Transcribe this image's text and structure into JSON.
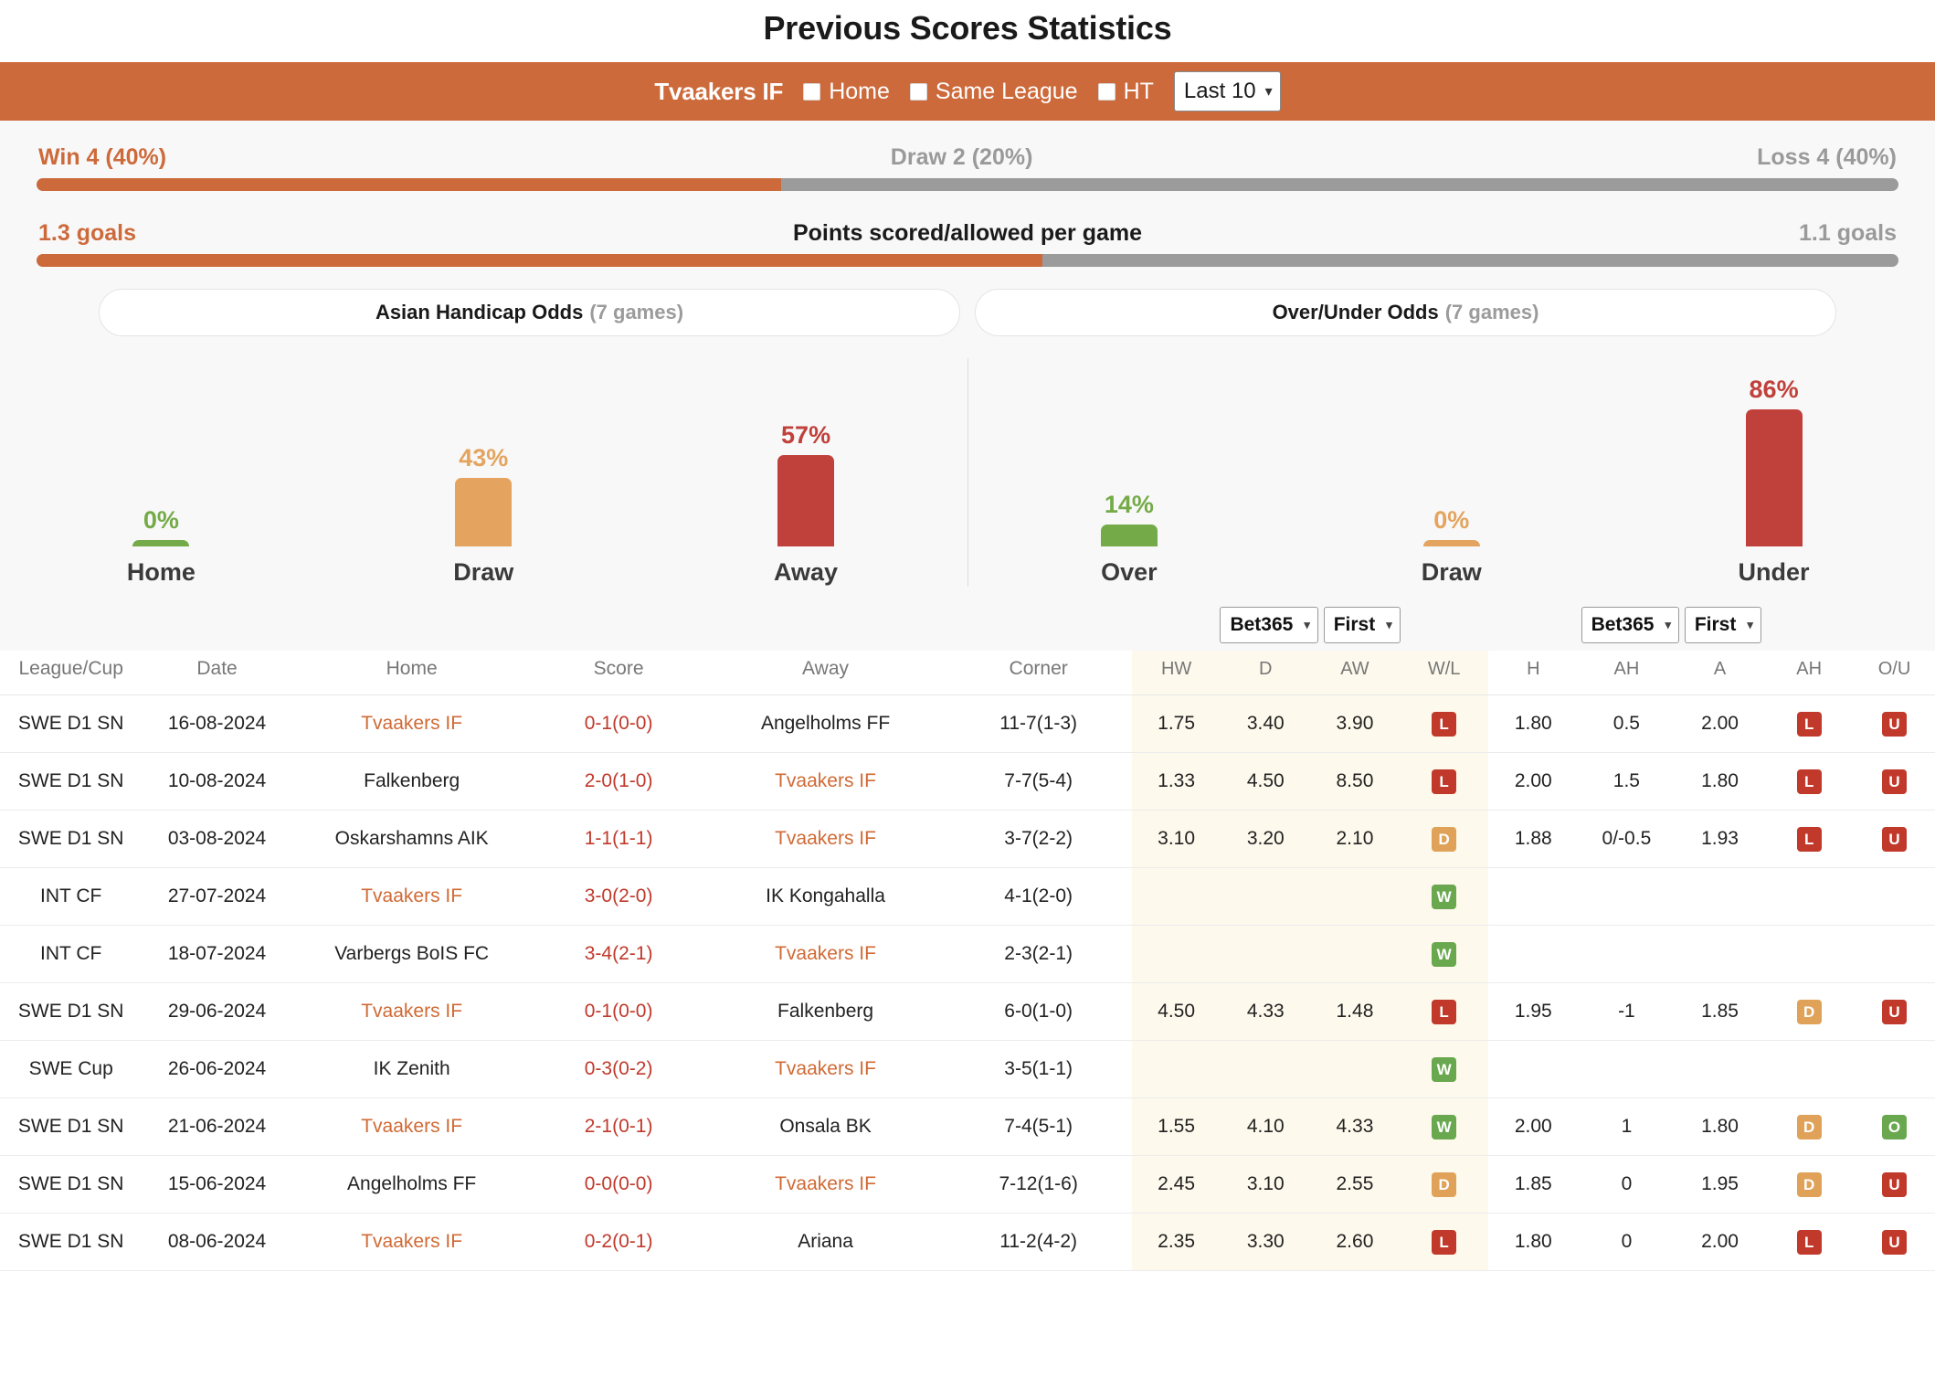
{
  "page_title": "Previous Scores Statistics",
  "filter": {
    "team": "Tvaakers IF",
    "checkboxes": [
      {
        "label": "Home",
        "checked": false
      },
      {
        "label": "Same League",
        "checked": false
      },
      {
        "label": "HT",
        "checked": false
      }
    ],
    "range_select": {
      "value": "Last 10",
      "caret": "chevron-down-icon"
    }
  },
  "summary": {
    "win_label": "Win 4 (40%)",
    "draw_label": "Draw 2 (20%)",
    "loss_label": "Loss 4 (40%)",
    "win_pct": 40,
    "goals_left": "1.3 goals",
    "goals_title": "Points scored/allowed per game",
    "goals_right": "1.1 goals",
    "goals_left_pct": 54,
    "accent_color": "#cd6a3b",
    "grey_color": "#9b9b9b"
  },
  "odds_tabs": [
    {
      "title": "Asian Handicap Odds",
      "games": "(7 games)"
    },
    {
      "title": "Over/Under Odds",
      "games": "(7 games)"
    }
  ],
  "chart_data": [
    {
      "type": "bar",
      "title": "Asian Handicap Odds",
      "categories": [
        "Home",
        "Draw",
        "Away"
      ],
      "values": [
        0,
        43,
        57
      ],
      "labels": [
        "0%",
        "43%",
        "57%"
      ],
      "colors": [
        "#74ab48",
        "#e4a45f",
        "#c0413c"
      ],
      "ylim": [
        0,
        100
      ],
      "ylabel": "",
      "xlabel": ""
    },
    {
      "type": "bar",
      "title": "Over/Under Odds",
      "categories": [
        "Over",
        "Draw",
        "Under"
      ],
      "values": [
        14,
        0,
        86
      ],
      "labels": [
        "14%",
        "0%",
        "86%"
      ],
      "colors": [
        "#74ab48",
        "#e4a45f",
        "#c0413c"
      ],
      "ylim": [
        0,
        100
      ],
      "ylabel": "",
      "xlabel": ""
    }
  ],
  "table": {
    "selectors": [
      {
        "bookmaker": "Bet365",
        "half": "First"
      },
      {
        "bookmaker": "Bet365",
        "half": "First"
      }
    ],
    "headers": {
      "league": "League/Cup",
      "date": "Date",
      "home": "Home",
      "score": "Score",
      "away": "Away",
      "corner": "Corner",
      "hw": "HW",
      "d": "D",
      "aw": "AW",
      "wl": "W/L",
      "h": "H",
      "ah": "AH",
      "a": "A",
      "ah2": "AH",
      "ou": "O/U"
    },
    "rows": [
      {
        "league": "SWE D1 SN",
        "date": "16-08-2024",
        "home": "Tvaakers IF",
        "home_hl": true,
        "score": "0-1",
        "score_ht": "(0-0)",
        "away": "Angelholms FF",
        "away_hl": false,
        "corner": "11-7(1-3)",
        "hw": "1.75",
        "d": "3.40",
        "aw": "3.90",
        "wl": "L",
        "h": "1.80",
        "ah": "0.5",
        "a": "2.00",
        "ah2": "L",
        "ou": "U"
      },
      {
        "league": "SWE D1 SN",
        "date": "10-08-2024",
        "home": "Falkenberg",
        "home_hl": false,
        "score": "2-0",
        "score_ht": "(1-0)",
        "away": "Tvaakers IF",
        "away_hl": true,
        "corner": "7-7(5-4)",
        "hw": "1.33",
        "d": "4.50",
        "aw": "8.50",
        "wl": "L",
        "h": "2.00",
        "ah": "1.5",
        "a": "1.80",
        "ah2": "L",
        "ou": "U"
      },
      {
        "league": "SWE D1 SN",
        "date": "03-08-2024",
        "home": "Oskarshamns AIK",
        "home_hl": false,
        "score": "1-1",
        "score_ht": "(1-1)",
        "away": "Tvaakers IF",
        "away_hl": true,
        "corner": "3-7(2-2)",
        "hw": "3.10",
        "d": "3.20",
        "aw": "2.10",
        "wl": "D",
        "h": "1.88",
        "ah": "0/-0.5",
        "a": "1.93",
        "ah2": "L",
        "ou": "U"
      },
      {
        "league": "INT CF",
        "date": "27-07-2024",
        "home": "Tvaakers IF",
        "home_hl": true,
        "score": "3-0",
        "score_ht": "(2-0)",
        "away": "IK Kongahalla",
        "away_hl": false,
        "corner": "4-1(2-0)",
        "hw": "",
        "d": "",
        "aw": "",
        "wl": "W",
        "h": "",
        "ah": "",
        "a": "",
        "ah2": "",
        "ou": ""
      },
      {
        "league": "INT CF",
        "date": "18-07-2024",
        "home": "Varbergs BoIS FC",
        "home_hl": false,
        "score": "3-4",
        "score_ht": "(2-1)",
        "away": "Tvaakers IF",
        "away_hl": true,
        "corner": "2-3(2-1)",
        "hw": "",
        "d": "",
        "aw": "",
        "wl": "W",
        "h": "",
        "ah": "",
        "a": "",
        "ah2": "",
        "ou": ""
      },
      {
        "league": "SWE D1 SN",
        "date": "29-06-2024",
        "home": "Tvaakers IF",
        "home_hl": true,
        "score": "0-1",
        "score_ht": "(0-0)",
        "away": "Falkenberg",
        "away_hl": false,
        "corner": "6-0(1-0)",
        "hw": "4.50",
        "d": "4.33",
        "aw": "1.48",
        "wl": "L",
        "h": "1.95",
        "ah": "-1",
        "a": "1.85",
        "ah2": "D",
        "ou": "U"
      },
      {
        "league": "SWE Cup",
        "date": "26-06-2024",
        "home": "IK Zenith",
        "home_hl": false,
        "score": "0-3",
        "score_ht": "(0-2)",
        "away": "Tvaakers IF",
        "away_hl": true,
        "corner": "3-5(1-1)",
        "hw": "",
        "d": "",
        "aw": "",
        "wl": "W",
        "h": "",
        "ah": "",
        "a": "",
        "ah2": "",
        "ou": ""
      },
      {
        "league": "SWE D1 SN",
        "date": "21-06-2024",
        "home": "Tvaakers IF",
        "home_hl": true,
        "score": "2-1",
        "score_ht": "(0-1)",
        "away": "Onsala BK",
        "away_hl": false,
        "corner": "7-4(5-1)",
        "hw": "1.55",
        "d": "4.10",
        "aw": "4.33",
        "wl": "W",
        "h": "2.00",
        "ah": "1",
        "a": "1.80",
        "ah2": "D",
        "ou": "O"
      },
      {
        "league": "SWE D1 SN",
        "date": "15-06-2024",
        "home": "Angelholms FF",
        "home_hl": false,
        "score": "0-0",
        "score_ht": "(0-0)",
        "away": "Tvaakers IF",
        "away_hl": true,
        "corner": "7-12(1-6)",
        "hw": "2.45",
        "d": "3.10",
        "aw": "2.55",
        "wl": "D",
        "h": "1.85",
        "ah": "0",
        "a": "1.95",
        "ah2": "D",
        "ou": "U"
      },
      {
        "league": "SWE D1 SN",
        "date": "08-06-2024",
        "home": "Tvaakers IF",
        "home_hl": true,
        "score": "0-2",
        "score_ht": "(0-1)",
        "away": "Ariana",
        "away_hl": false,
        "corner": "11-2(4-2)",
        "hw": "2.35",
        "d": "3.30",
        "aw": "2.60",
        "wl": "L",
        "h": "1.80",
        "ah": "0",
        "a": "2.00",
        "ah2": "L",
        "ou": "U"
      }
    ]
  }
}
